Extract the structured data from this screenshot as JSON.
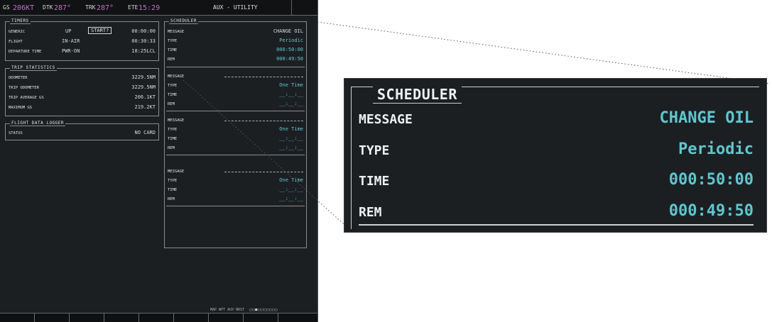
{
  "topbar": {
    "gs_label": "GS",
    "gs_value": "206KT",
    "dtk_label": "DTK",
    "dtk_value": "287°",
    "trk_label": "TRK",
    "trk_value": "287°",
    "ete_label": "ETE",
    "ete_value": "15:29",
    "page_title": "AUX - UTILITY"
  },
  "timers": {
    "title": "TIMERS",
    "generic_label": "GENERIC",
    "generic_dir": "UP",
    "generic_button": "START?",
    "generic_value": "00:00:00",
    "flight_label": "FLIGHT",
    "flight_mode": "IN-AIR",
    "flight_value": "00:30:33",
    "departure_label": "DEPARTURE TIME",
    "departure_mode": "PWR-ON",
    "departure_value": "18:25LCL"
  },
  "trip": {
    "title": "TRIP STATISTICS",
    "rows": [
      {
        "label": "ODOMETER",
        "value": "3229.5NM"
      },
      {
        "label": "TRIP ODOMETER",
        "value": "3229.5NM"
      },
      {
        "label": "TRIP AVERAGE GS",
        "value": "206.1KT"
      },
      {
        "label": "MAXIMUM GS",
        "value": "219.2KT"
      }
    ]
  },
  "logger": {
    "title": "FLIGHT DATA LOGGER",
    "status_label": "STATUS",
    "status_value": "NO CARD"
  },
  "scheduler": {
    "title": "SCHEDULER",
    "first": {
      "message_label": "MESSAGE",
      "message_value": "CHANGE OIL",
      "type_label": "TYPE",
      "type_value": "Periodic",
      "time_label": "TIME",
      "time_value": "000:50:00",
      "rem_label": "REM",
      "rem_value": "000:49:50"
    },
    "empty_groups": [
      {
        "message_label": "MESSAGE",
        "type_label": "TYPE",
        "type_value": "One Time",
        "time_label": "TIME",
        "time_value": "__:__:__",
        "rem_label": "REM",
        "rem_value": "__:__:__"
      },
      {
        "message_label": "MESSAGE",
        "type_label": "TYPE",
        "type_value": "One Time",
        "time_label": "TIME",
        "time_value": "__:__:__",
        "rem_label": "REM",
        "rem_value": "__:__:__"
      },
      {
        "message_label": "MESSAGE",
        "type_label": "TYPE",
        "type_value": "One Time",
        "time_label": "TIME",
        "time_value": "__:__:__",
        "rem_label": "REM",
        "rem_value": "__:__:__"
      }
    ]
  },
  "statusbar": {
    "text": "MAP WPT AUX NRST"
  },
  "colors": {
    "cyan": "#5fc7cf",
    "magenta": "#c071c9",
    "background": "#1c1f22"
  }
}
